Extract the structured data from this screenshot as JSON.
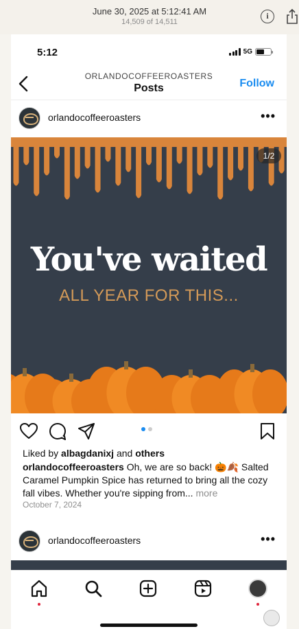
{
  "viewer": {
    "date": "June 30, 2025 at 5:12:41 AM",
    "count": "14,509 of 14,511",
    "info_icon": "info-icon",
    "share_icon": "share-icon"
  },
  "status": {
    "time": "5:12",
    "network": "5G",
    "battery_level": 0.55
  },
  "nav": {
    "subtitle": "ORLANDOCOFFEEROASTERS",
    "title": "Posts",
    "follow_label": "Follow"
  },
  "post": {
    "username": "orlandocoffeeroasters",
    "page_counter": "1/2",
    "headline": "You've waited",
    "subline": "ALL YEAR FOR THIS...",
    "liked_prefix": "Liked by ",
    "liked_user": "albagdanixj",
    "liked_and": " and ",
    "liked_others": "others",
    "caption_user": "orlandocoffeeroasters",
    "caption_text": " Oh, we are so back! 🎃🍂 Salted Caramel Pumpkin Spice has returned to bring all the cozy fall vibes. Whether you're sipping from...",
    "more_label": " more",
    "date": "October 7, 2024",
    "carousel": {
      "count": 2,
      "active": 1
    },
    "colors": {
      "background": "#353e4a",
      "caramel": "#d9853b",
      "subline": "#d49a58",
      "accent": "#1a8cf0"
    }
  },
  "next_post": {
    "username": "orlandocoffeeroasters"
  },
  "tabs": [
    "home-icon",
    "search-icon",
    "create-icon",
    "reels-icon",
    "profile-avatar"
  ]
}
